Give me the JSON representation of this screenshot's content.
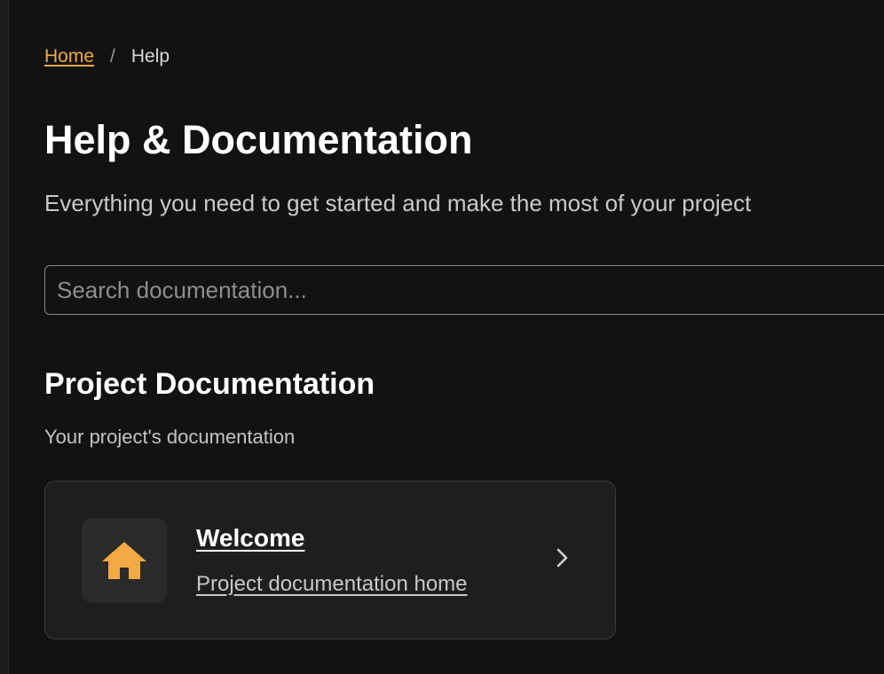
{
  "breadcrumb": {
    "home_label": "Home",
    "separator": "/",
    "current_label": "Help"
  },
  "header": {
    "title": "Help & Documentation",
    "subtitle": "Everything you need to get started and make the most of your project"
  },
  "search": {
    "placeholder": "Search documentation...",
    "value": ""
  },
  "section": {
    "title": "Project Documentation",
    "subtitle": "Your project's documentation"
  },
  "cards": [
    {
      "title": "Welcome",
      "description": "Project documentation home",
      "icon": "home-icon",
      "trailing_icon": "chevron-right-icon"
    }
  ],
  "colors": {
    "background": "#121212",
    "accent": "#f3a944",
    "card_background": "#1e1e1e",
    "card_border": "#3c3c3c"
  }
}
